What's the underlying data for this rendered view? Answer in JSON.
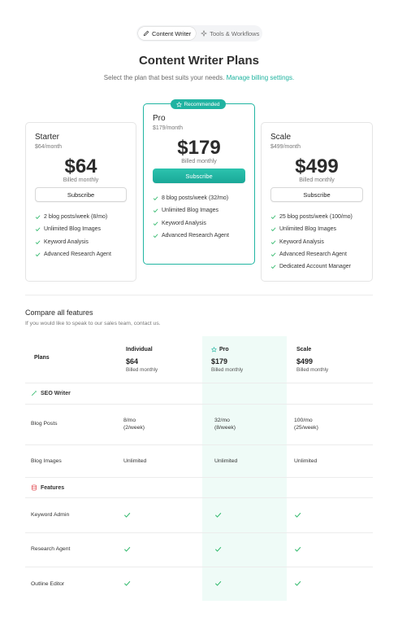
{
  "tabs": [
    {
      "label": "Content Writer",
      "icon": "pencil-icon",
      "active": true
    },
    {
      "label": "Tools & Workflows",
      "icon": "sparkle-icon",
      "active": false
    }
  ],
  "header": {
    "title": "Content Writer Plans",
    "subtitle": "Select the plan that best suits your needs.",
    "link": "Manage billing settings."
  },
  "badge": "Recommended",
  "plans": [
    {
      "name": "Starter",
      "monthly": "$64/month",
      "price": "$64",
      "billed": "Billed monthly",
      "cta": "Subscribe",
      "features": [
        "2 blog posts/week (8/mo)",
        "Unlimited Blog Images",
        "Keyword Analysis",
        "Advanced Research Agent"
      ]
    },
    {
      "name": "Pro",
      "monthly": "$179/month",
      "price": "$179",
      "billed": "Billed monthly",
      "cta": "Subscribe",
      "features": [
        "8 blog posts/week (32/mo)",
        "Unlimited Blog Images",
        "Keyword Analysis",
        "Advanced Research Agent"
      ]
    },
    {
      "name": "Scale",
      "monthly": "$499/month",
      "price": "$499",
      "billed": "Billed monthly",
      "cta": "Subscribe",
      "features": [
        "25 blog posts/week (100/mo)",
        "Unlimited Blog Images",
        "Keyword Analysis",
        "Advanced Research Agent",
        "Dedicated Account Manager"
      ]
    }
  ],
  "compare": {
    "title": "Compare all features",
    "subtitle": "If you would like to speak to our sales team, contact us.",
    "plans_label": "Plans",
    "columns": [
      {
        "name": "Individual",
        "price": "$64",
        "billed": "Billed monthly"
      },
      {
        "name": "Pro",
        "price": "$179",
        "billed": "Billed monthly"
      },
      {
        "name": "Scale",
        "price": "$499",
        "billed": "Billed monthly"
      }
    ],
    "sections": [
      {
        "name": "SEO Writer",
        "icon": "wand-icon",
        "rows": [
          {
            "label": "Blog Posts",
            "values": [
              [
                "8/mo",
                "(2/week)"
              ],
              [
                "32/mo",
                "(8/week)"
              ],
              [
                "100/mo",
                "(25/week)"
              ]
            ]
          },
          {
            "label": "Blog Images",
            "values": [
              "Unlimited",
              "Unlimited",
              "Unlimited"
            ]
          }
        ]
      },
      {
        "name": "Features",
        "icon": "database-icon",
        "rows": [
          {
            "label": "Keyword Admin",
            "values": [
              "check",
              "check",
              "check"
            ]
          },
          {
            "label": "Research Agent",
            "values": [
              "check",
              "check",
              "check"
            ]
          },
          {
            "label": "Outline Editor",
            "values": [
              "check",
              "check",
              "check"
            ]
          }
        ]
      }
    ]
  },
  "colors": {
    "accent": "#20b3a1",
    "check": "#2fb86a",
    "pro_column": "#effbf7",
    "section_icon_seo": "#2fb86a",
    "section_icon_features": "#e2545a"
  }
}
